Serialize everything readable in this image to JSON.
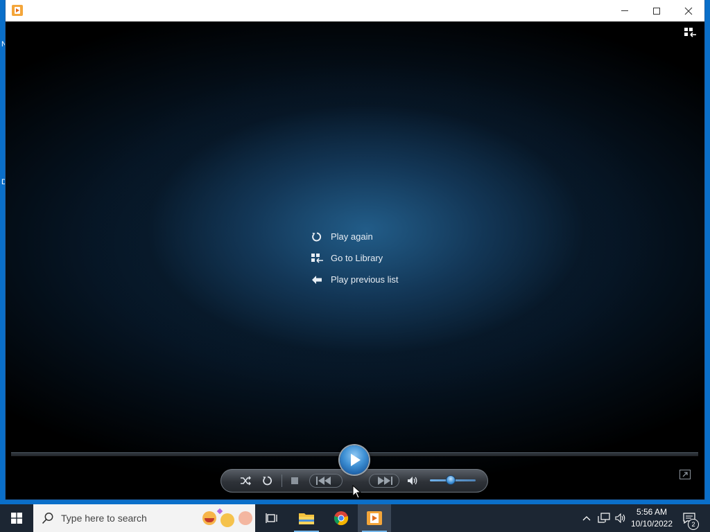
{
  "desktop": {
    "edge_glyph_1": "N",
    "edge_glyph_2": "D"
  },
  "window": {
    "controls": {
      "minimize": "minimize-icon",
      "maximize": "maximize-icon",
      "close": "close-icon"
    }
  },
  "player": {
    "menu": [
      {
        "label": "Play again",
        "icon": "replay-icon"
      },
      {
        "label": "Go to Library",
        "icon": "library-icon"
      },
      {
        "label": "Play previous list",
        "icon": "back-arrow-icon"
      }
    ],
    "volume_level": 0.45
  },
  "taskbar": {
    "search_placeholder": "Type here to search",
    "time": "5:56 AM",
    "date": "10/10/2022",
    "notification_count": "2"
  }
}
